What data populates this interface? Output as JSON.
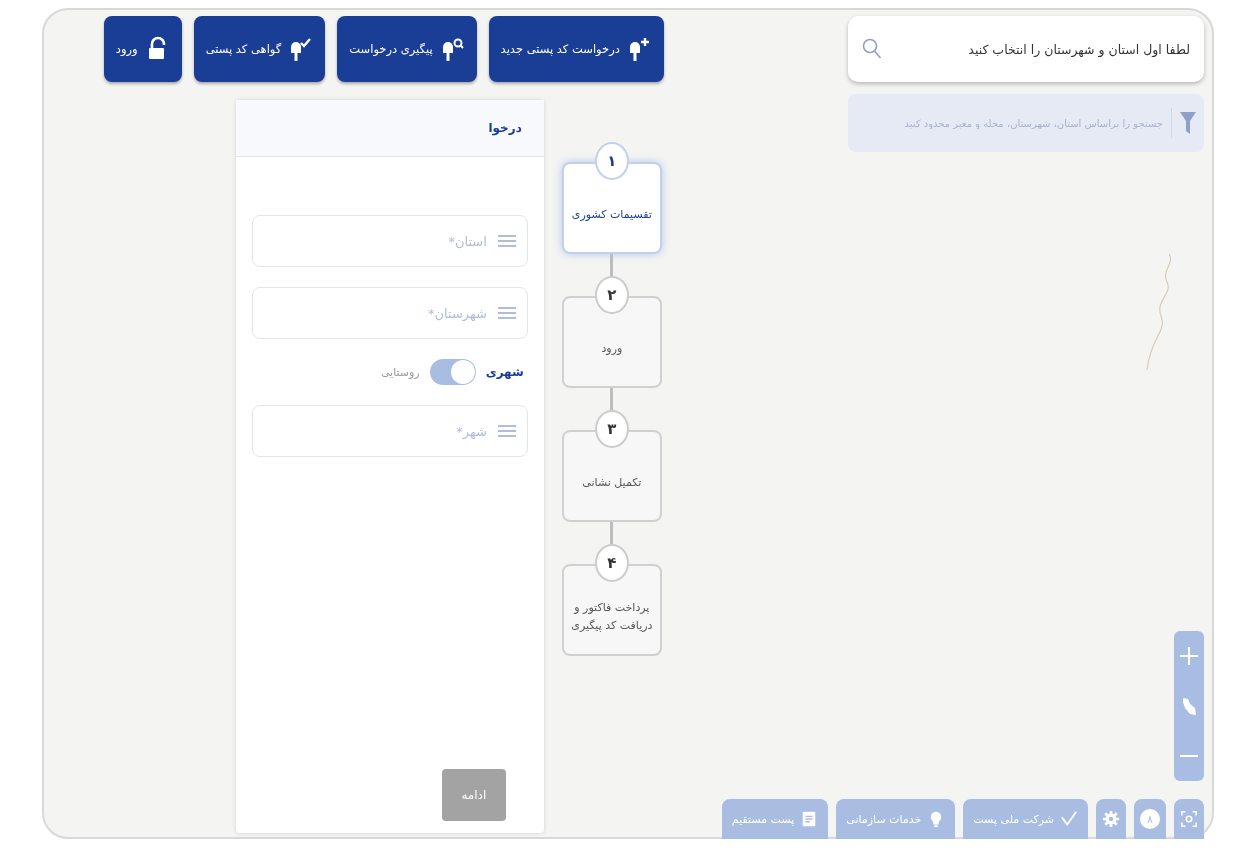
{
  "top_buttons": [
    {
      "label": "درخواست کد پستی جدید"
    },
    {
      "label": "پیگیری درخواست"
    },
    {
      "label": "گواهی کد پستی"
    },
    {
      "label": "ورود"
    }
  ],
  "panel": {
    "title": "درخوا",
    "fields": [
      {
        "placeholder": "استان*"
      },
      {
        "placeholder": "شهرستان*"
      }
    ],
    "area_toggle": [
      {
        "label": "شهری",
        "selected": true
      },
      {
        "label": "روستایی",
        "selected": false
      }
    ],
    "city_field": {
      "placeholder": "شهر*"
    },
    "continue_button": {
      "label": "ادامه",
      "disabled": true
    }
  },
  "steps": [
    {
      "number": "۱",
      "label": "تقسیمات کشوری",
      "selected": true
    },
    {
      "number": "۲",
      "label": "ورود",
      "selected": false
    },
    {
      "number": "۳",
      "label": "تکمیل نشانی",
      "selected": false
    },
    {
      "number": "۴",
      "label": "پرداخت فاکتور و دریافت کد پیگیری",
      "selected": false
    }
  ],
  "search": {
    "placeholder": "لطفا اول استان و شهرستان را انتخاب کنید"
  },
  "filter": {
    "placeholder": "جستجو را براساس استان، شهرستان، محله و معبر محدود کنید"
  },
  "bottom_toolbar": [
    {
      "kind": "icon"
    },
    {
      "kind": "text",
      "label": "۸"
    },
    {
      "kind": "icon"
    },
    {
      "kind": "labeled",
      "label": "شرکت ملی پست"
    },
    {
      "kind": "labeled",
      "label": "خدمات سازمانی"
    },
    {
      "kind": "labeled",
      "label": "پست مستقیم"
    }
  ]
}
